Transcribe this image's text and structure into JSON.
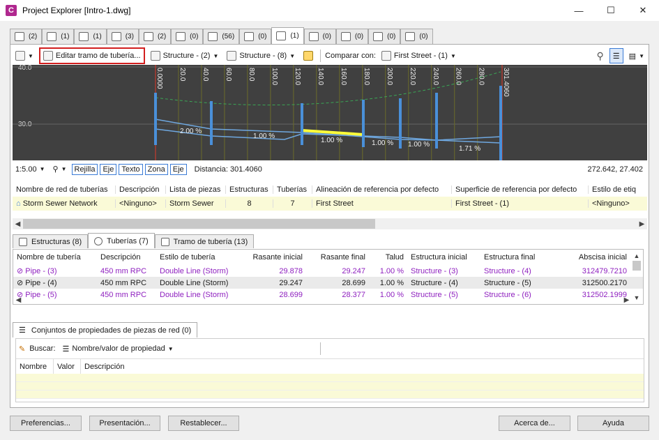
{
  "window": {
    "title": "Project Explorer [Intro-1.dwg]",
    "app_icon_letter": "C",
    "min": "—",
    "max": "☐",
    "close": "✕"
  },
  "top_tabs": [
    {
      "icon": "alignment-icon",
      "count": "(2)"
    },
    {
      "icon": "site-icon",
      "count": "(1)"
    },
    {
      "icon": "surface-icon",
      "count": "(1)"
    },
    {
      "icon": "profile-view-icon",
      "count": "(3)"
    },
    {
      "icon": "parcel-icon",
      "count": "(2)"
    },
    {
      "icon": "feature-line-icon",
      "count": "(0)"
    },
    {
      "icon": "corridor-icon",
      "count": "(56)"
    },
    {
      "icon": "sample-lines-icon",
      "count": "(0)"
    },
    {
      "icon": "pipe-network-icon",
      "count": "(1)"
    },
    {
      "icon": "pressure-network-icon",
      "count": "(0)"
    },
    {
      "icon": "assembly-icon",
      "count": "(0)"
    },
    {
      "icon": "catchment-icon",
      "count": "(0)"
    },
    {
      "icon": "data-shortcut-icon",
      "count": "(0)"
    }
  ],
  "toolbar": {
    "edit_run": "Editar tramo de tubería...",
    "structure_a": "Structure - (2)",
    "structure_b": "Structure - (8)",
    "compare_label": "Comparar con:",
    "compare_value": "First Street - (1)"
  },
  "profile": {
    "y_labels": [
      "40.0",
      "30.0"
    ],
    "x_labels": [
      "0.0000",
      "20.0",
      "40.0",
      "60.0",
      "80.0",
      "100.0",
      "120.0",
      "140.0",
      "160.0",
      "180.0",
      "200.0",
      "220.0",
      "240.0",
      "260.0",
      "280.0",
      "301.4060"
    ],
    "slopes": [
      "2.00 %",
      "1.00 %",
      "1.00 %",
      "1.00 %",
      "1.00 %",
      "1.71 %"
    ]
  },
  "profile_bar": {
    "scale": "1:5.00",
    "buttons": [
      "Rejilla",
      "Eje",
      "Texto",
      "Zona",
      "Eje"
    ],
    "distance": "Distancia: 301.4060",
    "coords": "272.642, 27.402"
  },
  "network_grid": {
    "headers": [
      "Nombre de red de tuberías",
      "Descripción",
      "Lista de piezas",
      "Estructuras",
      "Tuberías",
      "Alineación de referencia por defecto",
      "Superficie de referencia por defecto",
      "Estilo de etiq"
    ],
    "row": [
      "Storm Sewer Network",
      "<Ninguno>",
      "Storm Sewer",
      "8",
      "7",
      "First Street",
      "First Street - (1)",
      "<Ninguno>"
    ]
  },
  "bottom_tabs": [
    {
      "label": "Estructuras (8)"
    },
    {
      "label": "Tuberías (7)"
    },
    {
      "label": "Tramo de tubería (13)"
    }
  ],
  "pipes_grid": {
    "headers": [
      "Nombre de tubería",
      "Descripción",
      "Estilo de tubería",
      "Rasante inicial",
      "Rasante final",
      "Talud",
      "Estructura inicial",
      "Estructura final",
      "Abscisa inicial"
    ],
    "rows": [
      [
        "Pipe - (3)",
        "450 mm RPC",
        "Double Line (Storm)",
        "29.878",
        "29.247",
        "1.00 %",
        "Structure - (3)",
        "Structure - (4)",
        "312479.7210"
      ],
      [
        "Pipe - (4)",
        "450 mm RPC",
        "Double Line (Storm)",
        "29.247",
        "28.699",
        "1.00 %",
        "Structure - (4)",
        "Structure - (5)",
        "312500.2170"
      ],
      [
        "Pipe - (5)",
        "450 mm RPC",
        "Double Line (Storm)",
        "28.699",
        "28.377",
        "1.00 %",
        "Structure - (5)",
        "Structure - (6)",
        "312502.1999"
      ]
    ]
  },
  "property_sets": {
    "tab": "Conjuntos de propiedades de piezas de red (0)",
    "search_label": "Buscar:",
    "search_value": "Nombre/valor de propiedad",
    "headers": [
      "Nombre",
      "Valor",
      "Descripción"
    ]
  },
  "buttons": {
    "prefs": "Preferencias...",
    "presentation": "Presentación...",
    "reset": "Restablecer...",
    "about": "Acerca de...",
    "help": "Ayuda"
  },
  "colors": {
    "accent": "#3a7bd5",
    "highlight_red": "#d21e1e",
    "purple": "#8e1fbf",
    "row_yellow": "#fafad7"
  }
}
